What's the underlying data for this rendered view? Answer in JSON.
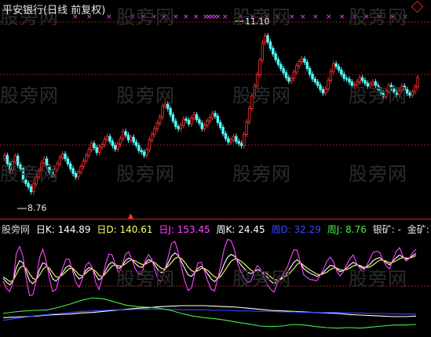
{
  "title": "平安银行(日线 前复权)",
  "watermark": "股旁网",
  "colors": {
    "background": "#000000",
    "up": "#ff3232",
    "down": "#54ffff",
    "grid": "#9a1c1c",
    "k": "#ffffff",
    "d": "#ffff66",
    "j": "#ff44ff",
    "wk": "#ffffff",
    "wd": "#3a46ff",
    "wj": "#44ee44"
  },
  "price": {
    "high_label": "11.10",
    "low_label": "8.76"
  },
  "legend": {
    "name": "股旁网",
    "k": "日K: 144.89",
    "d": "日D: 140.61",
    "j": "日J: 153.45",
    "wk": "周K: 24.45",
    "wd": "周D: 32.29",
    "wj": "周J: 8.76",
    "silver": "银矿: -",
    "gold": "金矿: -"
  },
  "chart_data": [
    {
      "type": "candlestick",
      "ylim": [
        8.5,
        11.3
      ],
      "annotations": [
        "11.10",
        "8.76"
      ],
      "close": [
        9.36,
        9.24,
        9.15,
        9.27,
        9.35,
        9.22,
        9.17,
        9.01,
        8.96,
        8.91,
        8.84,
        8.95,
        9.05,
        9.14,
        9.25,
        9.31,
        9.2,
        9.12,
        9.08,
        9.16,
        9.24,
        9.33,
        9.38,
        9.31,
        9.24,
        9.17,
        9.1,
        9.05,
        9.12,
        9.2,
        9.28,
        9.36,
        9.44,
        9.53,
        9.47,
        9.4,
        9.48,
        9.51,
        9.59,
        9.63,
        9.56,
        9.5,
        9.45,
        9.52,
        9.6,
        9.7,
        9.65,
        9.58,
        9.62,
        9.55,
        9.5,
        9.43,
        9.41,
        9.36,
        9.44,
        9.58,
        9.66,
        9.74,
        9.82,
        9.91,
        10.06,
        10.09,
        10.03,
        9.94,
        9.85,
        9.77,
        9.74,
        9.79,
        9.88,
        9.86,
        9.81,
        9.89,
        9.94,
        9.87,
        9.82,
        9.74,
        9.79,
        9.85,
        9.9,
        9.96,
        9.92,
        9.83,
        9.76,
        9.67,
        9.6,
        9.55,
        9.58,
        9.63,
        9.56,
        9.53,
        9.5,
        9.66,
        9.84,
        10.03,
        10.21,
        10.35,
        10.51,
        10.72,
        10.97,
        11.07,
        10.98,
        10.89,
        10.81,
        10.73,
        10.66,
        10.6,
        10.54,
        10.47,
        10.42,
        10.46,
        10.55,
        10.64,
        10.7,
        10.74,
        10.69,
        10.6,
        10.52,
        10.45,
        10.41,
        10.36,
        10.3,
        10.25,
        10.31,
        10.43,
        10.56,
        10.67,
        10.63,
        10.58,
        10.52,
        10.46,
        10.45,
        10.41,
        10.36,
        10.37,
        10.41,
        10.47,
        10.43,
        10.39,
        10.35,
        10.38,
        10.41,
        10.36,
        10.3,
        10.25,
        10.2,
        10.28,
        10.36,
        10.32,
        10.27,
        10.23,
        10.29,
        10.35,
        10.3,
        10.25,
        10.22,
        10.27,
        10.34,
        10.47
      ],
      "up_color": "#ff3232",
      "down_color": "#54ffff"
    },
    {
      "type": "line",
      "ylim": [
        0,
        180
      ],
      "series": [
        {
          "name": "日K",
          "color": "#ffffff",
          "values": [
            97,
            90,
            85,
            92,
            118,
            131,
            127,
            110,
            92,
            87,
            94,
            114,
            127,
            124,
            111,
            96,
            92,
            99,
            108,
            118,
            122,
            115,
            104,
            96,
            100,
            112,
            118,
            116,
            104,
            94,
            99,
            112,
            124,
            128,
            123,
            116,
            121,
            131,
            136,
            133,
            126,
            120,
            118,
            126,
            133,
            131,
            122,
            112,
            108,
            115,
            127,
            140,
            146,
            141,
            129,
            116,
            104,
            101,
            108,
            117,
            120,
            114,
            105,
            96,
            91,
            97,
            110,
            126,
            138,
            143,
            140,
            131,
            123,
            116,
            109,
            106,
            110,
            114,
            112,
            106,
            99,
            92,
            87,
            92,
            96,
            102,
            108,
            118,
            128,
            133,
            127,
            116,
            111,
            107,
            104,
            101,
            104,
            109,
            116,
            122,
            121,
            115,
            110,
            112,
            117,
            123,
            128,
            124,
            120,
            116,
            119,
            124,
            131,
            135,
            137,
            132,
            127,
            123,
            130,
            137,
            142,
            138,
            134,
            136,
            141,
            145
          ]
        },
        {
          "name": "日D",
          "color": "#ffff66",
          "values": [
            100,
            96,
            91,
            93,
            105,
            117,
            121,
            116,
            106,
            97,
            95,
            103,
            114,
            120,
            117,
            108,
            100,
            100,
            104,
            110,
            116,
            117,
            111,
            104,
            102,
            107,
            113,
            115,
            111,
            103,
            100,
            106,
            114,
            121,
            123,
            121,
            121,
            125,
            130,
            133,
            131,
            127,
            124,
            124,
            128,
            130,
            127,
            121,
            116,
            115,
            121,
            128,
            135,
            138,
            135,
            128,
            119,
            112,
            109,
            112,
            116,
            116,
            112,
            106,
            100,
            97,
            102,
            111,
            121,
            130,
            134,
            134,
            130,
            125,
            119,
            113,
            110,
            110,
            111,
            110,
            106,
            100,
            95,
            94,
            95,
            99,
            103,
            109,
            116,
            124,
            127,
            122,
            117,
            113,
            109,
            105,
            104,
            106,
            109,
            114,
            117,
            117,
            114,
            113,
            114,
            117,
            121,
            123,
            122,
            119,
            118,
            119,
            123,
            128,
            132,
            132,
            130,
            127,
            128,
            131,
            135,
            137,
            136,
            136,
            138,
            141
          ]
        },
        {
          "name": "日J",
          "color": "#ff44ff",
          "values": [
            92,
            78,
            72,
            90,
            145,
            158,
            140,
            96,
            64,
            66,
            92,
            136,
            153,
            131,
            98,
            72,
            76,
            97,
            116,
            134,
            134,
            111,
            90,
            80,
            96,
            122,
            128,
            118,
            90,
            76,
            97,
            124,
            144,
            142,
            123,
            106,
            121,
            143,
            148,
            133,
            116,
            106,
            106,
            130,
            143,
            133,
            112,
            94,
            92,
            115,
            139,
            164,
            168,
            147,
            118,
            92,
            74,
            79,
            106,
            127,
            128,
            110,
            91,
            76,
            73,
            97,
            126,
            156,
            172,
            169,
            152,
            125,
            109,
            98,
            89,
            92,
            110,
            122,
            114,
            98,
            85,
            76,
            71,
            88,
            98,
            108,
            118,
            136,
            152,
            151,
            127,
            104,
            99,
            95,
            94,
            93,
            104,
            115,
            130,
            138,
            129,
            111,
            102,
            110,
            123,
            135,
            142,
            126,
            116,
            110,
            121,
            134,
            147,
            149,
            147,
            132,
            121,
            115,
            134,
            149,
            156,
            140,
            130,
            136,
            147,
            153
          ]
        },
        {
          "name": "周K",
          "color": "#ffffff",
          "values": [
            22,
            23,
            24,
            25,
            27,
            28,
            29,
            31,
            32,
            34,
            36,
            38,
            40,
            41,
            43,
            44,
            45,
            45,
            45,
            44,
            43,
            42,
            40,
            38,
            36,
            35,
            34,
            33,
            32,
            31,
            30,
            28,
            27,
            26,
            25,
            24,
            24,
            25
          ]
        },
        {
          "name": "周D",
          "color": "#3a46ff",
          "values": [
            17,
            20,
            23,
            26,
            28,
            30,
            32,
            34,
            35,
            36,
            37,
            37,
            38,
            38,
            38,
            38,
            37,
            37,
            37,
            36,
            36,
            35,
            35,
            34,
            34,
            33,
            33,
            32,
            32,
            32,
            32,
            31,
            31,
            30,
            30,
            29,
            29,
            29
          ]
        },
        {
          "name": "周J",
          "color": "#44ee44",
          "values": [
            30,
            33,
            35,
            36,
            37,
            42,
            48,
            55,
            60,
            58,
            52,
            46,
            43,
            42,
            40,
            36,
            30,
            25,
            22,
            20,
            17,
            13,
            10,
            6,
            5,
            6,
            9,
            8,
            5,
            3,
            2,
            3,
            2,
            4,
            6,
            8,
            8,
            9
          ]
        }
      ]
    }
  ]
}
